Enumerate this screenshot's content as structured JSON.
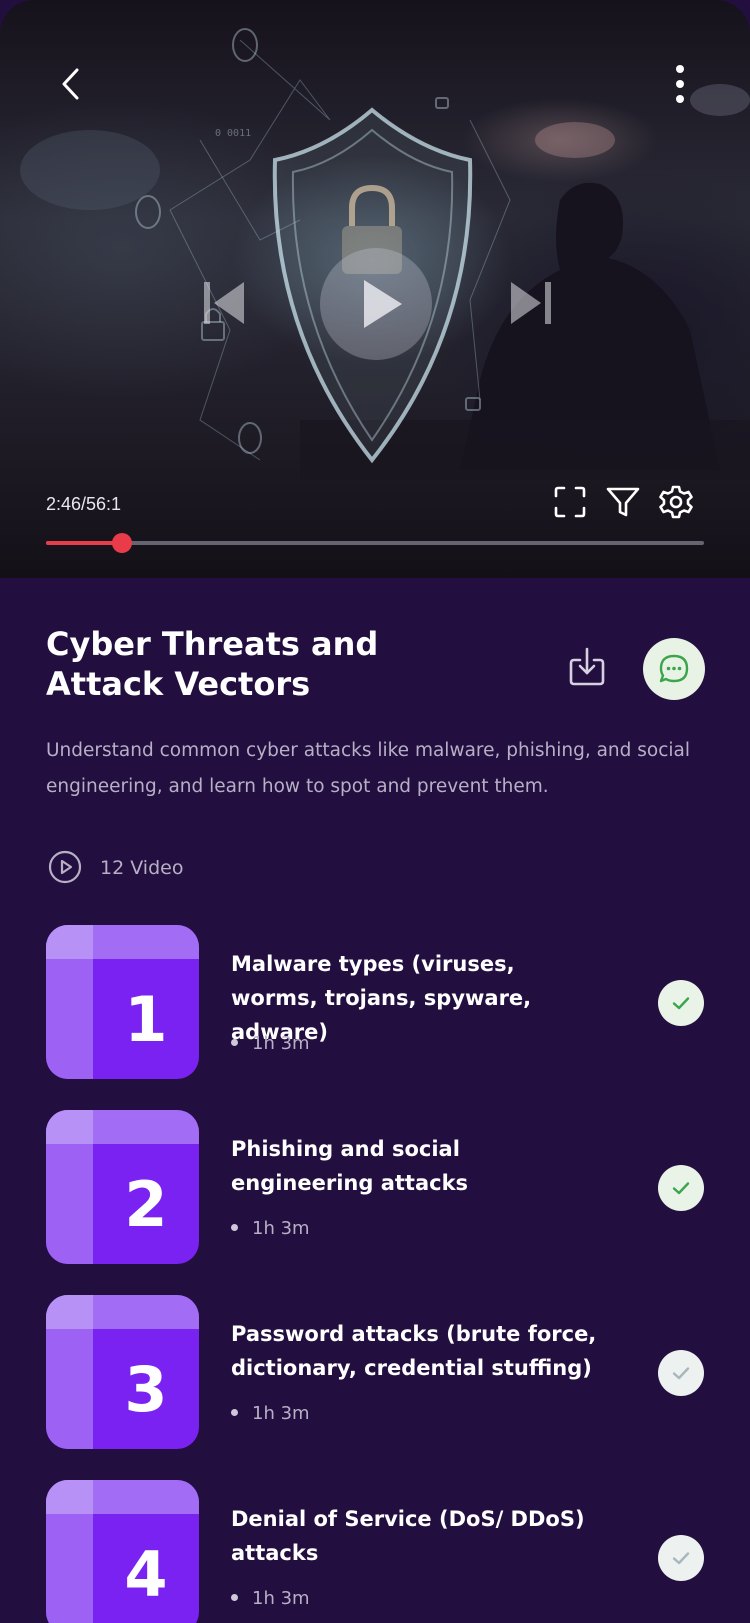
{
  "player": {
    "time": "2:46/56:1",
    "progress_fraction": 0.115,
    "progress_color": "#e53d4a"
  },
  "course": {
    "title": "Cyber Threats and Attack Vectors",
    "description": "Understand common cyber attacks like malware, phishing, and social engineering, and learn how to spot and prevent them.",
    "video_count": "12 Video"
  },
  "lessons": [
    {
      "number": "1",
      "title": "Malware types (viruses, worms, trojans, spyware, adware)",
      "duration": "1h 3m",
      "completed": true
    },
    {
      "number": "2",
      "title": "Phishing and social engineering attacks",
      "duration": "1h 3m",
      "completed": true
    },
    {
      "number": "3",
      "title": "Password attacks (brute force, dictionary, credential stuffing)",
      "duration": "1h 3m",
      "completed": false
    },
    {
      "number": "4",
      "title": "Denial of Service (DoS/ DDoS) attacks",
      "duration": "1h 3m",
      "completed": false
    }
  ],
  "icons": {
    "back": "chevron-left-icon",
    "more": "more-vertical-icon",
    "prev": "skip-previous-icon",
    "play": "play-icon",
    "next": "skip-next-icon",
    "fullscreen": "fullscreen-icon",
    "filter": "filter-icon",
    "settings": "gear-icon",
    "download": "download-icon",
    "chat": "chat-icon",
    "video": "play-circle-icon",
    "check": "check-icon"
  },
  "colors": {
    "background": "#220f3f",
    "thumb_accent": "#7a22f2",
    "check_done": "#3aa54a",
    "check_pending": "#a8b7bd"
  }
}
